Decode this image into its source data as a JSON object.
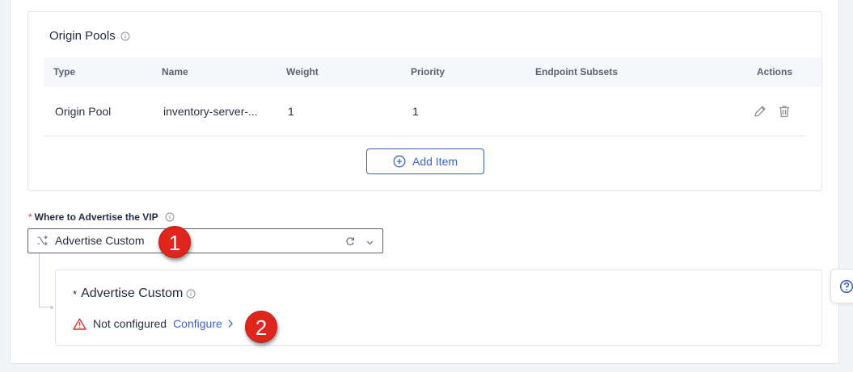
{
  "origin_pools": {
    "title": "Origin Pools",
    "columns": [
      "Type",
      "Name",
      "Weight",
      "Priority",
      "Endpoint Subsets",
      "Actions"
    ],
    "rows": [
      {
        "type": "Origin Pool",
        "name": "inventory-server-...",
        "weight": "1",
        "priority": "1",
        "endpoint_subsets": ""
      }
    ],
    "add_item_label": "Add Item"
  },
  "vip": {
    "required_mark": "*",
    "label": "Where to Advertise the VIP",
    "selected": "Advertise Custom"
  },
  "advertise_custom": {
    "required_mark": "*",
    "title": "Advertise Custom",
    "status": "Not configured",
    "configure_label": "Configure"
  },
  "annotations": [
    "1",
    "2"
  ],
  "colors": {
    "accent": "#3d63c9",
    "badge": "#e0261c",
    "warning": "#d0342c"
  },
  "icons": {
    "title_info": "info-icon",
    "edit": "pencil-icon",
    "delete": "trash-icon",
    "add": "plus-circle-icon",
    "select": "route-split-icon",
    "refresh": "refresh-icon",
    "dropdown": "chevron-down-icon",
    "warning": "warning-triangle-icon",
    "configure": "chevron-right-icon",
    "help": "help-circle-icon"
  }
}
